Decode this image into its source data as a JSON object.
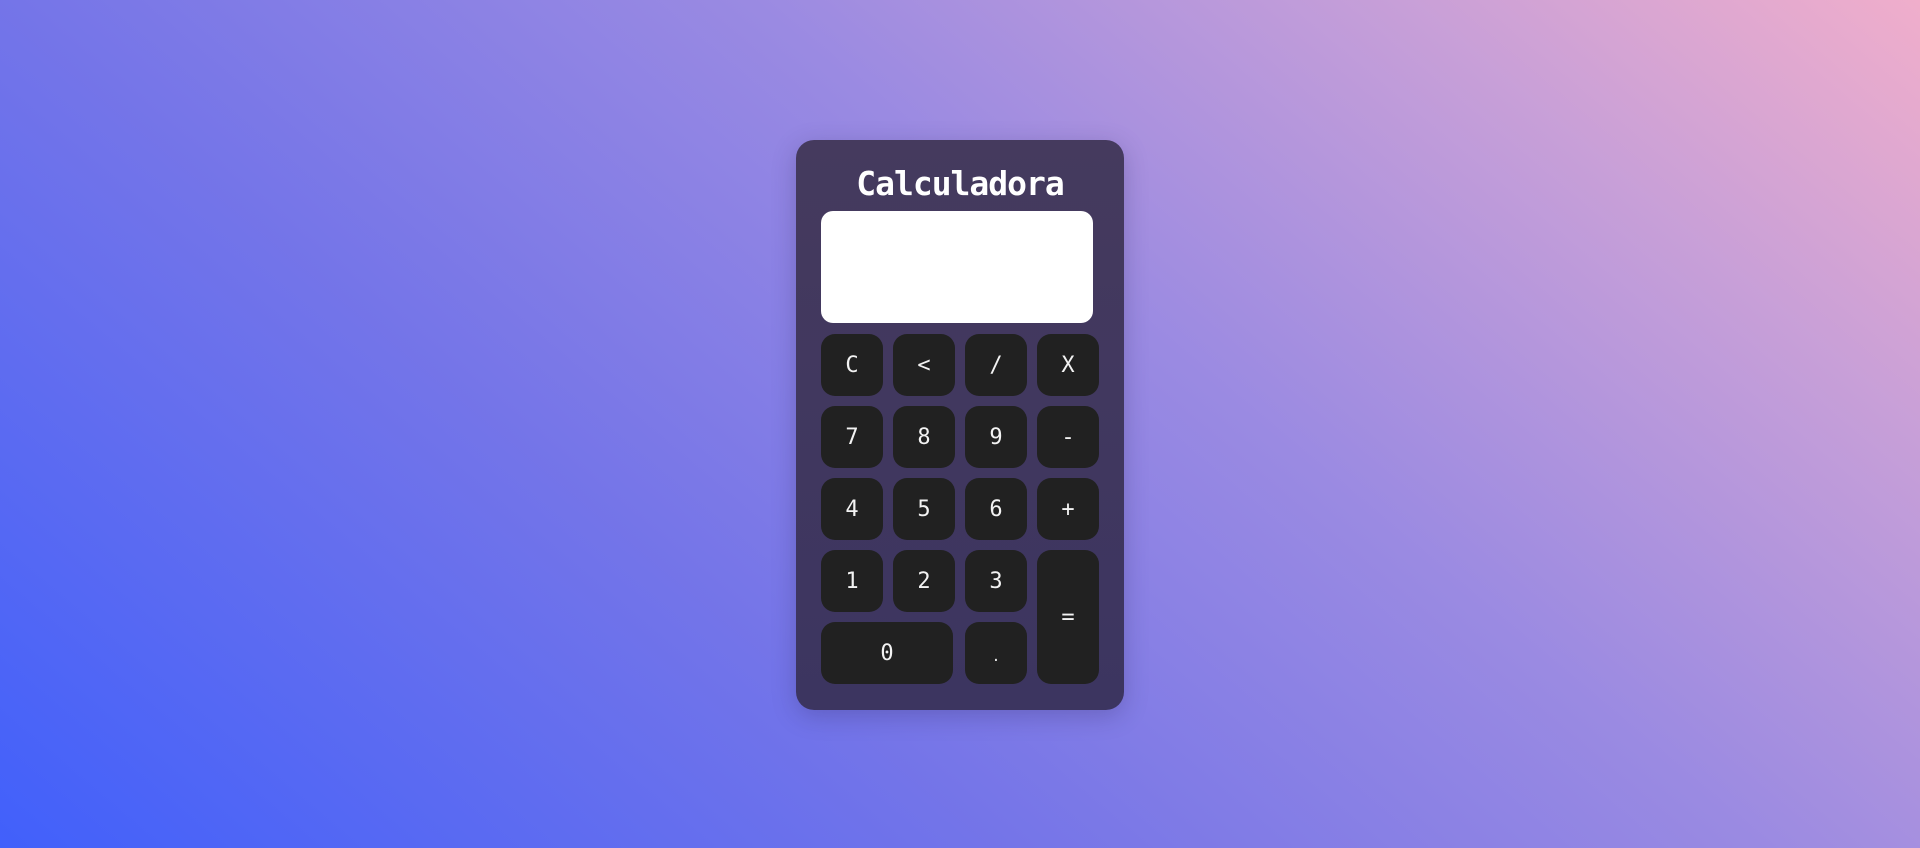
{
  "app": {
    "title": "Calculadora"
  },
  "display": {
    "value": ""
  },
  "keys": {
    "clear": "C",
    "backspace": "<",
    "divide": "/",
    "multiply": "X",
    "seven": "7",
    "eight": "8",
    "nine": "9",
    "subtract": "-",
    "four": "4",
    "five": "5",
    "six": "6",
    "add": "+",
    "one": "1",
    "two": "2",
    "three": "3",
    "equals": "=",
    "zero": "0",
    "decimal": "."
  },
  "colors": {
    "background_start": "#4160fb",
    "background_end": "#f0aecb",
    "panel": "#3f375e",
    "display": "#ffffff",
    "key": "#212121",
    "key_text": "#f3f3f3"
  }
}
